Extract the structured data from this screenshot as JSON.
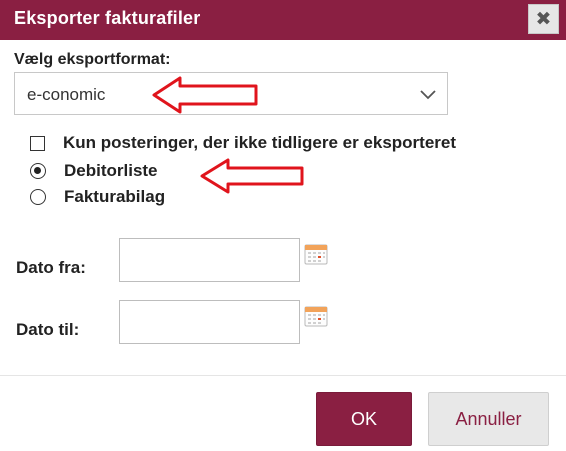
{
  "dialog": {
    "title": "Eksporter fakturafiler",
    "close_glyph": "✖"
  },
  "format": {
    "label": "Vælg eksportformat:",
    "selected": "e-conomic"
  },
  "options": {
    "only_new_label": "Kun posteringer, der ikke tidligere er eksporteret",
    "only_new_checked": false,
    "radio_debitor_label": "Debitorliste",
    "radio_faktura_label": "Fakturabilag",
    "selected_radio": "Debitorliste"
  },
  "dates": {
    "from_label": "Dato fra:",
    "from_value": "",
    "to_label": "Dato til:",
    "to_value": ""
  },
  "buttons": {
    "ok": "OK",
    "cancel": "Annuller"
  },
  "colors": {
    "brand": "#8a1f42",
    "annotation": "#e0141c"
  },
  "icons": [
    "close-icon",
    "chevron-down-icon",
    "calendar-icon",
    "red-arrow-annotation"
  ]
}
